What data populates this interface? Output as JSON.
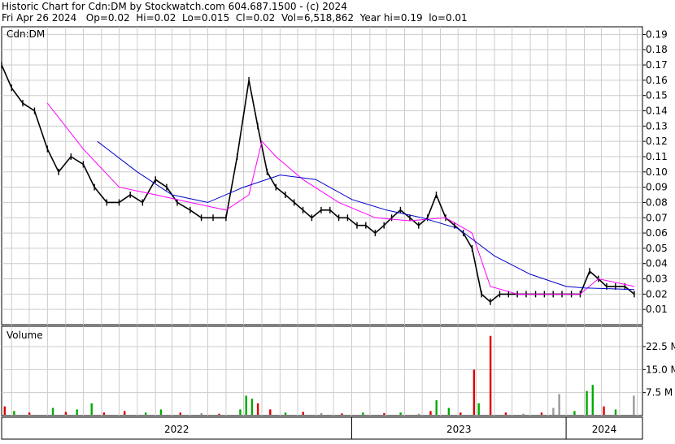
{
  "header": {
    "line1": "Historic Chart for Cdn:DM by Stockwatch.com 604.687.1500 - (c) 2024",
    "line2": "Fri Apr 26 2024   Op=0.02  Hi=0.02  Lo=0.015  Cl=0.02  Vol=6,518,862  Year hi=0.19  lo=0.01"
  },
  "chart_data": [
    {
      "type": "line",
      "panel": "price",
      "title": "Cdn:DM",
      "ylim": [
        0,
        0.195
      ],
      "yticks": [
        "0.19",
        "0.18",
        "0.17",
        "0.16",
        "0.15",
        "0.14",
        "0.13",
        "0.12",
        "0.11",
        "0.10",
        "0.09",
        "0.08",
        "0.07",
        "0.06",
        "0.05",
        "0.04",
        "0.03",
        "0.02",
        "0.01"
      ],
      "ytick_values": [
        0.19,
        0.18,
        0.17,
        0.16,
        0.15,
        0.14,
        0.13,
        0.12,
        0.11,
        0.1,
        0.09,
        0.08,
        0.07,
        0.06,
        0.05,
        0.04,
        0.03,
        0.02,
        0.01
      ],
      "x_labels": [
        "2022",
        "2023",
        "2024"
      ],
      "x_label_dates": [
        "2022-01-01",
        "2023-01-01",
        "2024-01-01"
      ],
      "x_range": [
        "2021-05-15",
        "2024-05-10"
      ],
      "grid": true,
      "colors": {
        "price": "#000000",
        "ma_short": "#ff00ff",
        "ma_long": "#0000cc",
        "grid": "#cccccc"
      },
      "price_series": {
        "x": [
          "2021-05-15",
          "2021-06-01",
          "2021-06-20",
          "2021-07-10",
          "2021-08-01",
          "2021-08-20",
          "2021-09-10",
          "2021-10-01",
          "2021-10-20",
          "2021-11-10",
          "2021-12-01",
          "2021-12-20",
          "2022-01-10",
          "2022-02-01",
          "2022-02-20",
          "2022-03-10",
          "2022-04-01",
          "2022-04-20",
          "2022-05-10",
          "2022-06-01",
          "2022-06-20",
          "2022-07-10",
          "2022-07-25",
          "2022-08-10",
          "2022-08-25",
          "2022-09-10",
          "2022-09-25",
          "2022-10-10",
          "2022-10-25",
          "2022-11-10",
          "2022-11-25",
          "2022-12-10",
          "2022-12-25",
          "2023-01-10",
          "2023-01-25",
          "2023-02-10",
          "2023-02-25",
          "2023-03-10",
          "2023-03-25",
          "2023-04-10",
          "2023-04-25",
          "2023-05-10",
          "2023-05-25",
          "2023-06-10",
          "2023-06-25",
          "2023-07-10",
          "2023-07-25",
          "2023-08-10",
          "2023-08-25",
          "2023-09-10",
          "2023-09-25",
          "2023-10-10",
          "2023-10-25",
          "2023-11-10",
          "2023-11-25",
          "2023-12-10",
          "2023-12-25",
          "2024-01-10",
          "2024-01-25",
          "2024-02-10",
          "2024-02-25",
          "2024-03-10",
          "2024-03-25",
          "2024-04-10",
          "2024-04-26"
        ],
        "y": [
          0.17,
          0.155,
          0.145,
          0.14,
          0.115,
          0.1,
          0.11,
          0.105,
          0.09,
          0.08,
          0.08,
          0.085,
          0.08,
          0.095,
          0.09,
          0.08,
          0.075,
          0.07,
          0.07,
          0.07,
          0.11,
          0.16,
          0.13,
          0.1,
          0.09,
          0.085,
          0.08,
          0.075,
          0.07,
          0.075,
          0.075,
          0.07,
          0.07,
          0.065,
          0.065,
          0.06,
          0.065,
          0.07,
          0.075,
          0.07,
          0.065,
          0.07,
          0.085,
          0.07,
          0.065,
          0.06,
          0.05,
          0.02,
          0.015,
          0.02,
          0.02,
          0.02,
          0.02,
          0.02,
          0.02,
          0.02,
          0.02,
          0.02,
          0.02,
          0.035,
          0.03,
          0.025,
          0.025,
          0.025,
          0.02
        ]
      },
      "ma_short": {
        "x": [
          "2021-08-01",
          "2021-10-01",
          "2021-12-01",
          "2022-02-01",
          "2022-04-01",
          "2022-06-01",
          "2022-07-10",
          "2022-08-01",
          "2022-08-25",
          "2022-10-10",
          "2022-12-10",
          "2023-02-10",
          "2023-04-10",
          "2023-06-10",
          "2023-07-25",
          "2023-08-25",
          "2023-10-10",
          "2023-12-10",
          "2024-01-25",
          "2024-02-25",
          "2024-04-26"
        ],
        "y": [
          0.145,
          0.115,
          0.09,
          0.085,
          0.08,
          0.075,
          0.085,
          0.12,
          0.11,
          0.095,
          0.08,
          0.07,
          0.068,
          0.07,
          0.06,
          0.025,
          0.02,
          0.02,
          0.02,
          0.03,
          0.025
        ]
      },
      "ma_long": {
        "x": [
          "2021-10-25",
          "2022-01-01",
          "2022-03-01",
          "2022-05-01",
          "2022-07-01",
          "2022-09-01",
          "2022-11-01",
          "2023-01-01",
          "2023-03-01",
          "2023-05-01",
          "2023-07-01",
          "2023-09-01",
          "2023-11-01",
          "2024-01-01",
          "2024-02-01",
          "2024-04-26"
        ],
        "y": [
          0.12,
          0.1,
          0.085,
          0.08,
          0.09,
          0.098,
          0.095,
          0.082,
          0.075,
          0.07,
          0.063,
          0.045,
          0.033,
          0.025,
          0.024,
          0.023
        ]
      }
    },
    {
      "type": "bar",
      "panel": "volume",
      "title": "Volume",
      "ylim": [
        0,
        27
      ],
      "yticks": [
        "22.5 M",
        "15.0 M",
        "7.5 M"
      ],
      "ytick_values": [
        22.5,
        15.0,
        7.5
      ],
      "units": "million shares",
      "colors": {
        "up": "#00aa00",
        "down": "#dd0000",
        "flat": "#999999"
      },
      "bars": [
        {
          "date": "2021-05-20",
          "value": 3.0,
          "dir": "down"
        },
        {
          "date": "2021-06-05",
          "value": 1.5,
          "dir": "up"
        },
        {
          "date": "2021-07-01",
          "value": 1.0,
          "dir": "down"
        },
        {
          "date": "2021-08-10",
          "value": 2.5,
          "dir": "up"
        },
        {
          "date": "2021-09-01",
          "value": 1.2,
          "dir": "down"
        },
        {
          "date": "2021-09-20",
          "value": 2.0,
          "dir": "up"
        },
        {
          "date": "2021-10-15",
          "value": 4.0,
          "dir": "up"
        },
        {
          "date": "2021-11-05",
          "value": 1.0,
          "dir": "down"
        },
        {
          "date": "2021-12-10",
          "value": 1.5,
          "dir": "down"
        },
        {
          "date": "2022-01-15",
          "value": 1.0,
          "dir": "up"
        },
        {
          "date": "2022-02-10",
          "value": 2.0,
          "dir": "up"
        },
        {
          "date": "2022-03-15",
          "value": 1.0,
          "dir": "down"
        },
        {
          "date": "2022-04-20",
          "value": 0.8,
          "dir": "flat"
        },
        {
          "date": "2022-05-20",
          "value": 0.6,
          "dir": "down"
        },
        {
          "date": "2022-06-25",
          "value": 2.0,
          "dir": "up"
        },
        {
          "date": "2022-07-05",
          "value": 6.5,
          "dir": "up"
        },
        {
          "date": "2022-07-15",
          "value": 5.5,
          "dir": "up"
        },
        {
          "date": "2022-07-25",
          "value": 4.0,
          "dir": "down"
        },
        {
          "date": "2022-08-15",
          "value": 2.0,
          "dir": "down"
        },
        {
          "date": "2022-09-10",
          "value": 1.0,
          "dir": "up"
        },
        {
          "date": "2022-10-10",
          "value": 1.2,
          "dir": "down"
        },
        {
          "date": "2022-11-10",
          "value": 0.8,
          "dir": "flat"
        },
        {
          "date": "2022-12-15",
          "value": 0.7,
          "dir": "down"
        },
        {
          "date": "2023-01-20",
          "value": 1.0,
          "dir": "up"
        },
        {
          "date": "2023-02-25",
          "value": 0.8,
          "dir": "down"
        },
        {
          "date": "2023-03-25",
          "value": 1.0,
          "dir": "up"
        },
        {
          "date": "2023-04-25",
          "value": 0.6,
          "dir": "flat"
        },
        {
          "date": "2023-05-15",
          "value": 1.5,
          "dir": "down"
        },
        {
          "date": "2023-05-25",
          "value": 5.0,
          "dir": "up"
        },
        {
          "date": "2023-06-15",
          "value": 2.5,
          "dir": "up"
        },
        {
          "date": "2023-07-05",
          "value": 1.0,
          "dir": "down"
        },
        {
          "date": "2023-07-28",
          "value": 15.0,
          "dir": "down"
        },
        {
          "date": "2023-08-05",
          "value": 4.0,
          "dir": "up"
        },
        {
          "date": "2023-08-25",
          "value": 26.0,
          "dir": "down"
        },
        {
          "date": "2023-09-20",
          "value": 1.0,
          "dir": "down"
        },
        {
          "date": "2023-10-20",
          "value": 0.6,
          "dir": "flat"
        },
        {
          "date": "2023-11-20",
          "value": 1.0,
          "dir": "down"
        },
        {
          "date": "2023-12-10",
          "value": 2.5,
          "dir": "flat"
        },
        {
          "date": "2023-12-20",
          "value": 7.0,
          "dir": "flat"
        },
        {
          "date": "2024-01-15",
          "value": 1.5,
          "dir": "up"
        },
        {
          "date": "2024-02-05",
          "value": 8.0,
          "dir": "up"
        },
        {
          "date": "2024-02-15",
          "value": 10.0,
          "dir": "up"
        },
        {
          "date": "2024-03-05",
          "value": 3.0,
          "dir": "down"
        },
        {
          "date": "2024-03-25",
          "value": 2.0,
          "dir": "up"
        },
        {
          "date": "2024-04-25",
          "value": 6.5,
          "dir": "flat"
        }
      ]
    }
  ]
}
